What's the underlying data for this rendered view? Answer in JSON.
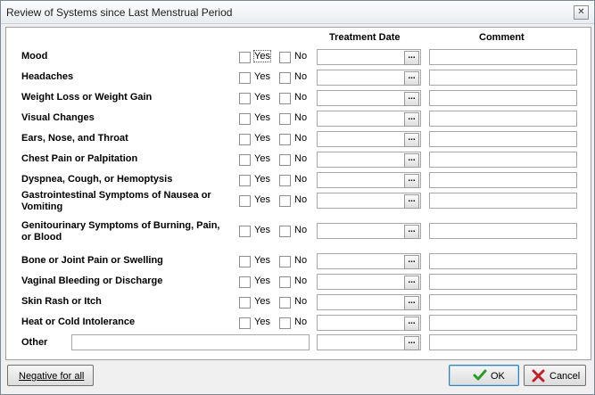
{
  "window": {
    "title": "Review of Systems since Last Menstrual Period",
    "close_glyph": "✕"
  },
  "headers": {
    "treatment_date": "Treatment Date",
    "comment": "Comment"
  },
  "options": {
    "yes": "Yes",
    "no": "No",
    "picker": "..."
  },
  "rows": [
    {
      "label": "Mood"
    },
    {
      "label": "Headaches"
    },
    {
      "label": "Weight Loss or Weight Gain"
    },
    {
      "label": "Visual Changes"
    },
    {
      "label": "Ears, Nose, and Throat"
    },
    {
      "label": "Chest Pain or Palpitation"
    },
    {
      "label": "Dyspnea, Cough, or Hemoptysis"
    },
    {
      "label": "Gastrointestinal Symptoms of Nausea or Vomiting"
    },
    {
      "label": "Genitourinary Symptoms of Burning, Pain, or Blood"
    },
    {
      "label": "Bone or Joint Pain or Swelling"
    },
    {
      "label": "Vaginal Bleeding or Discharge"
    },
    {
      "label": "Skin Rash or Itch"
    },
    {
      "label": "Heat or Cold Intolerance"
    }
  ],
  "other": {
    "label": "Other",
    "value": ""
  },
  "buttons": {
    "negative_all": "Negative for all",
    "ok": "OK",
    "cancel": "Cancel"
  },
  "icons": {
    "ok": "check-icon",
    "cancel": "x-icon"
  },
  "colors": {
    "ok_check": "#2a9a2a",
    "cancel_x": "#c0202a"
  }
}
